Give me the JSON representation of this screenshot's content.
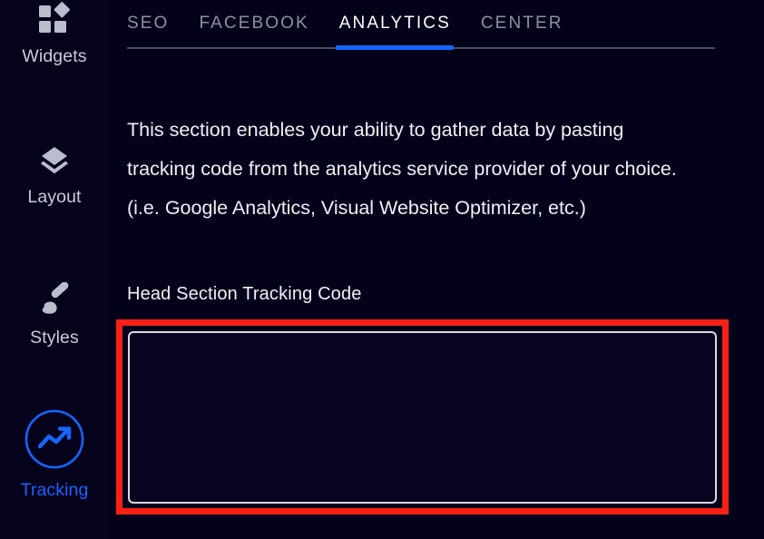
{
  "sidebar": {
    "items": [
      {
        "id": "widgets",
        "label": "Widgets",
        "icon": "widgets-icon",
        "active": false
      },
      {
        "id": "layout",
        "label": "Layout",
        "icon": "layers-icon",
        "active": false
      },
      {
        "id": "styles",
        "label": "Styles",
        "icon": "paintbrush-icon",
        "active": false
      },
      {
        "id": "tracking",
        "label": "Tracking",
        "icon": "trending-up-circle-icon",
        "active": true
      }
    ]
  },
  "tabs": [
    {
      "id": "seo",
      "label": "SEO",
      "active": false
    },
    {
      "id": "facebook",
      "label": "FACEBOOK",
      "active": false
    },
    {
      "id": "analytics",
      "label": "ANALYTICS",
      "active": true
    },
    {
      "id": "center",
      "label": "CENTER",
      "active": false
    }
  ],
  "content": {
    "intro": "This section enables your ability to gather data by pasting tracking code from the analytics service provider of your choice. (i.e. Google Analytics, Visual Website Optimizer, etc.)",
    "field_label": "Head Section Tracking Code",
    "textarea_value": "",
    "textarea_placeholder": ""
  },
  "colors": {
    "background": "#04021a",
    "accent_blue": "#1566ff",
    "highlight_red": "#fb2016",
    "text_primary": "#eef0f5",
    "text_muted": "#8c90a0",
    "icon_muted": "#b9bdcc"
  }
}
